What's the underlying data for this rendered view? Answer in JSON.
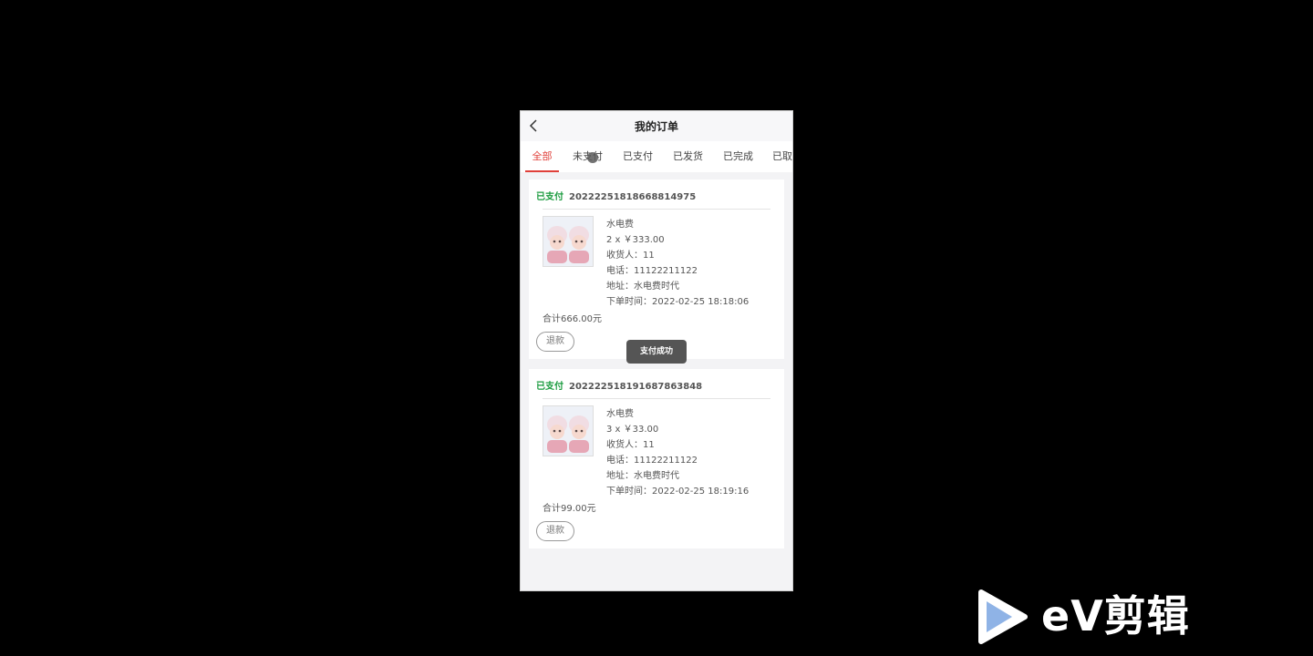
{
  "header": {
    "title": "我的订单"
  },
  "tabs": [
    {
      "label": "全部",
      "active": true
    },
    {
      "label": "未支付"
    },
    {
      "label": "已支付"
    },
    {
      "label": "已发货"
    },
    {
      "label": "已完成"
    },
    {
      "label": "已取"
    }
  ],
  "orders": [
    {
      "status": "已支付",
      "order_no": "20222251818668814975",
      "product": "水电费",
      "quantity_price": "2 x ￥333.00",
      "receiver": "收货人：11",
      "phone": "电话：11122211122",
      "address": "地址：水电费时代",
      "order_time": "下单时间：2022-02-25 18:18:06",
      "total": "合计666.00元",
      "refund_label": "退款"
    },
    {
      "status": "已支付",
      "order_no": "202222518191687863848",
      "product": "水电费",
      "quantity_price": "3 x ￥33.00",
      "receiver": "收货人：11",
      "phone": "电话：11122211122",
      "address": "地址：水电费时代",
      "order_time": "下单时间：2022-02-25 18:19:16",
      "total": "合计99.00元",
      "refund_label": "退款"
    }
  ],
  "toast": "支付成功",
  "watermark": {
    "text": "eV剪辑"
  },
  "colors": {
    "accent": "#e0403a",
    "paid_status": "#1a9b3e",
    "background": "#000000"
  }
}
